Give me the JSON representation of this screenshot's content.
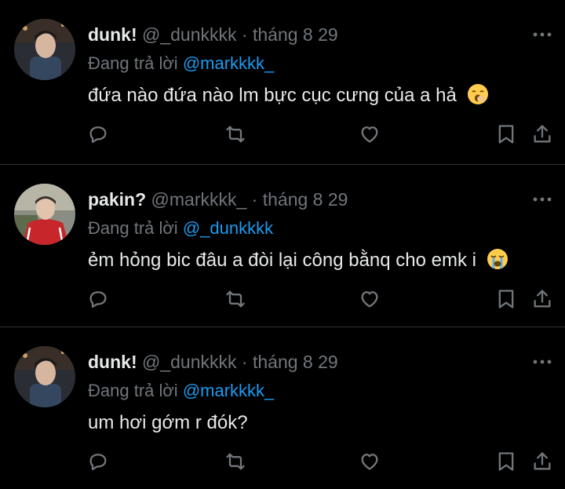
{
  "colors": {
    "background": "#000000",
    "text": "#e7e9ea",
    "muted": "#71767b",
    "link": "#1d9bf0",
    "divider": "#2f3336"
  },
  "reply_prefix": "Đang trả lời",
  "tweets": [
    {
      "display_name": "dunk!",
      "handle": "@_dunkkkk",
      "separator": "·",
      "date": "tháng 8 29",
      "replying_to": "@markkkk_",
      "text": "đứa nào đứa nào lm bực cục cưng của a hả",
      "emoji": "yawning-face-emoji"
    },
    {
      "display_name": "pakin?",
      "handle": "@markkkk_",
      "separator": "·",
      "date": "tháng 8 29",
      "replying_to": "@_dunkkkk",
      "text": "ẻm hỏng bic đâu a đòi lại công bằnq cho emk i",
      "emoji": "loudly-crying-face-emoji"
    },
    {
      "display_name": "dunk!",
      "handle": "@_dunkkkk",
      "separator": "·",
      "date": "tháng 8 29",
      "replying_to": "@markkkk_",
      "text": "um hơi gớm r đók?",
      "emoji": ""
    }
  ],
  "action_icons": [
    "reply-icon",
    "retweet-icon",
    "like-icon",
    "bookmark-icon",
    "share-icon"
  ]
}
